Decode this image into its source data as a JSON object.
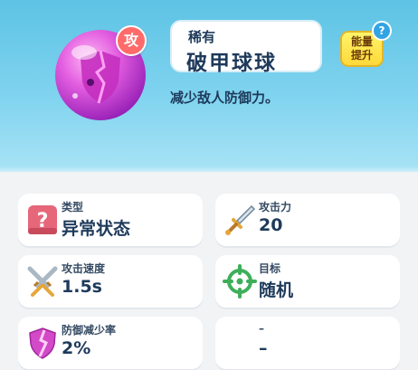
{
  "skill": {
    "attack_badge": "攻",
    "rarity": "稀有",
    "name": "破甲球球",
    "description": "减少敌人防御力。",
    "orb_icon": "cracked-shield-orb-icon"
  },
  "upgrade_button": {
    "line1": "能量",
    "line2": "提升"
  },
  "help": "?",
  "stats": [
    {
      "label": "类型",
      "value": "异常状态",
      "icon": "question-box-icon"
    },
    {
      "label": "攻击力",
      "value": "20",
      "icon": "sword-icon"
    },
    {
      "label": "攻击速度",
      "value": "1.5s",
      "icon": "crossed-swords-icon"
    },
    {
      "label": "目标",
      "value": "随机",
      "icon": "crosshair-icon"
    },
    {
      "label": "防御减少率",
      "value": "2%",
      "icon": "broken-shield-icon"
    },
    {
      "label": "–",
      "value": "–",
      "icon": ""
    }
  ],
  "colors": {
    "header": "#7fd3ef",
    "badge": "#ff6b6b",
    "orb": "#e050d8",
    "upgrade": "#ffe34d",
    "text": "#1e3a5b"
  }
}
